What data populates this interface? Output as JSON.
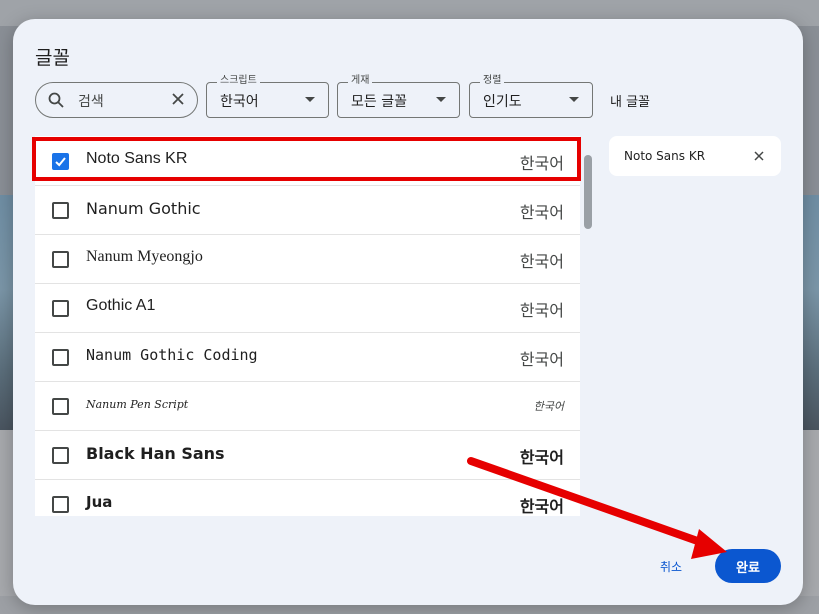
{
  "dialog": {
    "title": "글꼴",
    "search": {
      "value": "검색"
    },
    "filters": [
      {
        "legend": "스크립트",
        "value": "한국어"
      },
      {
        "legend": "게재",
        "value": "모든 글꼴"
      },
      {
        "legend": "정렬",
        "value": "인기도"
      }
    ],
    "my_fonts_label": "내 글꼴",
    "font_list": [
      {
        "name": "Noto Sans KR",
        "lang": "한국어",
        "checked": true
      },
      {
        "name": "Nanum Gothic",
        "lang": "한국어",
        "checked": false
      },
      {
        "name": "Nanum Myeongjo",
        "lang": "한국어",
        "checked": false
      },
      {
        "name": "Gothic A1",
        "lang": "한국어",
        "checked": false
      },
      {
        "name": "Nanum Gothic Coding",
        "lang": "한국어",
        "checked": false
      },
      {
        "name": "Nanum Pen Script",
        "lang": "한국어",
        "checked": false
      },
      {
        "name": "Black Han Sans",
        "lang": "한국어",
        "checked": false
      },
      {
        "name": "Jua",
        "lang": "한국어",
        "checked": false
      }
    ],
    "selected_fonts": [
      {
        "name": "Noto Sans KR"
      }
    ],
    "cancel_label": "취소",
    "done_label": "완료"
  },
  "colors": {
    "accent": "#0b57d0",
    "checkbox": "#1a73e8",
    "annotation": "#e60000"
  },
  "icons": [
    "search-icon",
    "clear-icon",
    "chevron-down-icon",
    "check-icon",
    "close-icon",
    "arrow-annotation"
  ]
}
